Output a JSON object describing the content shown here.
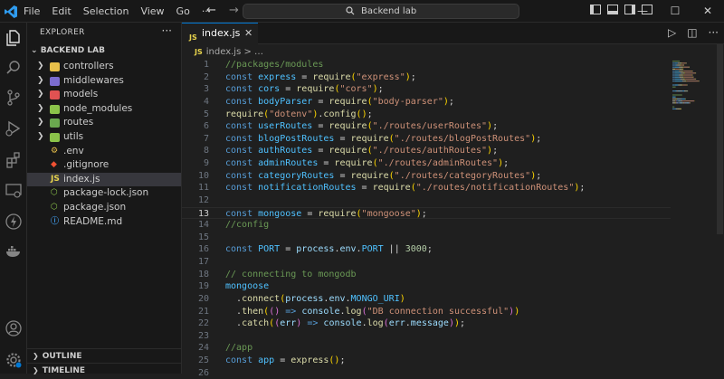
{
  "titlebar": {
    "menu": [
      "File",
      "Edit",
      "Selection",
      "View",
      "Go",
      "···"
    ],
    "search": "Backend lab",
    "win_min": "—",
    "win_max": "☐",
    "win_close": "✕"
  },
  "explorer": {
    "title": "EXPLORER",
    "more": "···",
    "root": "BACKEND LAB",
    "items": [
      {
        "label": "controllers",
        "type": "folder",
        "color": "#e8c04a"
      },
      {
        "label": "middlewares",
        "type": "folder",
        "color": "#7b6ccf"
      },
      {
        "label": "models",
        "type": "folder",
        "color": "#e05252"
      },
      {
        "label": "node_modules",
        "type": "folder",
        "color": "#8bc34a"
      },
      {
        "label": "routes",
        "type": "folder",
        "color": "#6aa84f"
      },
      {
        "label": "utils",
        "type": "folder",
        "color": "#8bc34a"
      },
      {
        "label": ".env",
        "type": "file",
        "glyph": "⚙",
        "color": "#e8c04a"
      },
      {
        "label": ".gitignore",
        "type": "file",
        "glyph": "◆",
        "color": "#f05133"
      },
      {
        "label": "index.js",
        "type": "file",
        "glyph": "JS",
        "color": "#e8d44d"
      },
      {
        "label": "package-lock.json",
        "type": "file",
        "glyph": "⬡",
        "color": "#8bc34a"
      },
      {
        "label": "package.json",
        "type": "file",
        "glyph": "⬡",
        "color": "#8bc34a"
      },
      {
        "label": "README.md",
        "type": "file",
        "glyph": "ⓘ",
        "color": "#3d8fd6"
      }
    ],
    "sections": [
      "OUTLINE",
      "TIMELINE"
    ]
  },
  "editor": {
    "tab": {
      "label": "index.js",
      "icon": "JS",
      "close": "✕"
    },
    "actions": [
      "▷",
      "◫",
      "···"
    ],
    "breadcrumb": {
      "icon": "JS",
      "file": "index.js",
      "sep": "> …"
    },
    "current_line": 13,
    "lines": [
      [
        {
          "t": "//packages/modules",
          "c": "#6a9955"
        }
      ],
      [
        {
          "t": "const ",
          "c": "#569cd6"
        },
        {
          "t": "express",
          "c": "#4fc1ff"
        },
        {
          "t": " = ",
          "c": "#d4d4d4"
        },
        {
          "t": "require",
          "c": "#dcdcaa"
        },
        {
          "t": "(",
          "c": "#ffd700"
        },
        {
          "t": "\"express\"",
          "c": "#ce9178"
        },
        {
          "t": ")",
          "c": "#ffd700"
        },
        {
          "t": ";",
          "c": "#d4d4d4"
        }
      ],
      [
        {
          "t": "const ",
          "c": "#569cd6"
        },
        {
          "t": "cors",
          "c": "#4fc1ff"
        },
        {
          "t": " = ",
          "c": "#d4d4d4"
        },
        {
          "t": "require",
          "c": "#dcdcaa"
        },
        {
          "t": "(",
          "c": "#ffd700"
        },
        {
          "t": "\"cors\"",
          "c": "#ce9178"
        },
        {
          "t": ")",
          "c": "#ffd700"
        },
        {
          "t": ";",
          "c": "#d4d4d4"
        }
      ],
      [
        {
          "t": "const ",
          "c": "#569cd6"
        },
        {
          "t": "bodyParser",
          "c": "#4fc1ff"
        },
        {
          "t": " = ",
          "c": "#d4d4d4"
        },
        {
          "t": "require",
          "c": "#dcdcaa"
        },
        {
          "t": "(",
          "c": "#ffd700"
        },
        {
          "t": "\"body-parser\"",
          "c": "#ce9178"
        },
        {
          "t": ")",
          "c": "#ffd700"
        },
        {
          "t": ";",
          "c": "#d4d4d4"
        }
      ],
      [
        {
          "t": "require",
          "c": "#dcdcaa"
        },
        {
          "t": "(",
          "c": "#ffd700"
        },
        {
          "t": "\"dotenv\"",
          "c": "#ce9178"
        },
        {
          "t": ")",
          "c": "#ffd700"
        },
        {
          "t": ".",
          "c": "#d4d4d4"
        },
        {
          "t": "config",
          "c": "#dcdcaa"
        },
        {
          "t": "()",
          "c": "#ffd700"
        },
        {
          "t": ";",
          "c": "#d4d4d4"
        }
      ],
      [
        {
          "t": "const ",
          "c": "#569cd6"
        },
        {
          "t": "userRoutes",
          "c": "#4fc1ff"
        },
        {
          "t": " = ",
          "c": "#d4d4d4"
        },
        {
          "t": "require",
          "c": "#dcdcaa"
        },
        {
          "t": "(",
          "c": "#ffd700"
        },
        {
          "t": "\"./routes/userRoutes\"",
          "c": "#ce9178"
        },
        {
          "t": ")",
          "c": "#ffd700"
        },
        {
          "t": ";",
          "c": "#d4d4d4"
        }
      ],
      [
        {
          "t": "const ",
          "c": "#569cd6"
        },
        {
          "t": "blogPostRoutes",
          "c": "#4fc1ff"
        },
        {
          "t": " = ",
          "c": "#d4d4d4"
        },
        {
          "t": "require",
          "c": "#dcdcaa"
        },
        {
          "t": "(",
          "c": "#ffd700"
        },
        {
          "t": "\"./routes/blogPostRoutes\"",
          "c": "#ce9178"
        },
        {
          "t": ")",
          "c": "#ffd700"
        },
        {
          "t": ";",
          "c": "#d4d4d4"
        }
      ],
      [
        {
          "t": "const ",
          "c": "#569cd6"
        },
        {
          "t": "authRoutes",
          "c": "#4fc1ff"
        },
        {
          "t": " = ",
          "c": "#d4d4d4"
        },
        {
          "t": "require",
          "c": "#dcdcaa"
        },
        {
          "t": "(",
          "c": "#ffd700"
        },
        {
          "t": "\"./routes/authRoutes\"",
          "c": "#ce9178"
        },
        {
          "t": ")",
          "c": "#ffd700"
        },
        {
          "t": ";",
          "c": "#d4d4d4"
        }
      ],
      [
        {
          "t": "const ",
          "c": "#569cd6"
        },
        {
          "t": "adminRoutes",
          "c": "#4fc1ff"
        },
        {
          "t": " = ",
          "c": "#d4d4d4"
        },
        {
          "t": "require",
          "c": "#dcdcaa"
        },
        {
          "t": "(",
          "c": "#ffd700"
        },
        {
          "t": "\"./routes/adminRoutes\"",
          "c": "#ce9178"
        },
        {
          "t": ")",
          "c": "#ffd700"
        },
        {
          "t": ";",
          "c": "#d4d4d4"
        }
      ],
      [
        {
          "t": "const ",
          "c": "#569cd6"
        },
        {
          "t": "categoryRoutes",
          "c": "#4fc1ff"
        },
        {
          "t": " = ",
          "c": "#d4d4d4"
        },
        {
          "t": "require",
          "c": "#dcdcaa"
        },
        {
          "t": "(",
          "c": "#ffd700"
        },
        {
          "t": "\"./routes/categoryRoutes\"",
          "c": "#ce9178"
        },
        {
          "t": ")",
          "c": "#ffd700"
        },
        {
          "t": ";",
          "c": "#d4d4d4"
        }
      ],
      [
        {
          "t": "const ",
          "c": "#569cd6"
        },
        {
          "t": "notificationRoutes",
          "c": "#4fc1ff"
        },
        {
          "t": " = ",
          "c": "#d4d4d4"
        },
        {
          "t": "require",
          "c": "#dcdcaa"
        },
        {
          "t": "(",
          "c": "#ffd700"
        },
        {
          "t": "\"./routes/notificationRoutes\"",
          "c": "#ce9178"
        },
        {
          "t": ")",
          "c": "#ffd700"
        },
        {
          "t": ";",
          "c": "#d4d4d4"
        }
      ],
      [],
      [
        {
          "t": "const ",
          "c": "#569cd6"
        },
        {
          "t": "mongoose",
          "c": "#4fc1ff"
        },
        {
          "t": " = ",
          "c": "#d4d4d4"
        },
        {
          "t": "require",
          "c": "#dcdcaa"
        },
        {
          "t": "(",
          "c": "#ffd700"
        },
        {
          "t": "\"mongoose\"",
          "c": "#ce9178"
        },
        {
          "t": ")",
          "c": "#ffd700"
        },
        {
          "t": ";",
          "c": "#d4d4d4"
        }
      ],
      [
        {
          "t": "//config",
          "c": "#6a9955"
        }
      ],
      [],
      [
        {
          "t": "const ",
          "c": "#569cd6"
        },
        {
          "t": "PORT",
          "c": "#4fc1ff"
        },
        {
          "t": " = ",
          "c": "#d4d4d4"
        },
        {
          "t": "process",
          "c": "#9cdcfe"
        },
        {
          "t": ".",
          "c": "#d4d4d4"
        },
        {
          "t": "env",
          "c": "#9cdcfe"
        },
        {
          "t": ".",
          "c": "#d4d4d4"
        },
        {
          "t": "PORT",
          "c": "#4fc1ff"
        },
        {
          "t": " || ",
          "c": "#d4d4d4"
        },
        {
          "t": "3000",
          "c": "#b5cea8"
        },
        {
          "t": ";",
          "c": "#d4d4d4"
        }
      ],
      [],
      [
        {
          "t": "// connecting to mongodb",
          "c": "#6a9955"
        }
      ],
      [
        {
          "t": "mongoose",
          "c": "#4fc1ff"
        }
      ],
      [
        {
          "t": "  .",
          "c": "#d4d4d4"
        },
        {
          "t": "connect",
          "c": "#dcdcaa"
        },
        {
          "t": "(",
          "c": "#ffd700"
        },
        {
          "t": "process",
          "c": "#9cdcfe"
        },
        {
          "t": ".",
          "c": "#d4d4d4"
        },
        {
          "t": "env",
          "c": "#9cdcfe"
        },
        {
          "t": ".",
          "c": "#d4d4d4"
        },
        {
          "t": "MONGO_URI",
          "c": "#4fc1ff"
        },
        {
          "t": ")",
          "c": "#ffd700"
        }
      ],
      [
        {
          "t": "  .",
          "c": "#d4d4d4"
        },
        {
          "t": "then",
          "c": "#dcdcaa"
        },
        {
          "t": "(",
          "c": "#ffd700"
        },
        {
          "t": "()",
          "c": "#da70d6"
        },
        {
          "t": " => ",
          "c": "#569cd6"
        },
        {
          "t": "console",
          "c": "#9cdcfe"
        },
        {
          "t": ".",
          "c": "#d4d4d4"
        },
        {
          "t": "log",
          "c": "#dcdcaa"
        },
        {
          "t": "(",
          "c": "#da70d6"
        },
        {
          "t": "\"DB connection successful\"",
          "c": "#ce9178"
        },
        {
          "t": ")",
          "c": "#da70d6"
        },
        {
          "t": ")",
          "c": "#ffd700"
        }
      ],
      [
        {
          "t": "  .",
          "c": "#d4d4d4"
        },
        {
          "t": "catch",
          "c": "#dcdcaa"
        },
        {
          "t": "(",
          "c": "#ffd700"
        },
        {
          "t": "(",
          "c": "#da70d6"
        },
        {
          "t": "err",
          "c": "#9cdcfe"
        },
        {
          "t": ")",
          "c": "#da70d6"
        },
        {
          "t": " => ",
          "c": "#569cd6"
        },
        {
          "t": "console",
          "c": "#9cdcfe"
        },
        {
          "t": ".",
          "c": "#d4d4d4"
        },
        {
          "t": "log",
          "c": "#dcdcaa"
        },
        {
          "t": "(",
          "c": "#da70d6"
        },
        {
          "t": "err",
          "c": "#9cdcfe"
        },
        {
          "t": ".",
          "c": "#d4d4d4"
        },
        {
          "t": "message",
          "c": "#9cdcfe"
        },
        {
          "t": ")",
          "c": "#da70d6"
        },
        {
          "t": ")",
          "c": "#ffd700"
        },
        {
          "t": ";",
          "c": "#d4d4d4"
        }
      ],
      [],
      [
        {
          "t": "//app",
          "c": "#6a9955"
        }
      ],
      [
        {
          "t": "const ",
          "c": "#569cd6"
        },
        {
          "t": "app",
          "c": "#4fc1ff"
        },
        {
          "t": " = ",
          "c": "#d4d4d4"
        },
        {
          "t": "express",
          "c": "#dcdcaa"
        },
        {
          "t": "()",
          "c": "#ffd700"
        },
        {
          "t": ";",
          "c": "#d4d4d4"
        }
      ],
      []
    ]
  },
  "colors": {
    "accent": "#0078d4",
    "editor_bg": "#1f1f1f",
    "chrome_bg": "#181818",
    "selection_bg": "#37373d"
  }
}
